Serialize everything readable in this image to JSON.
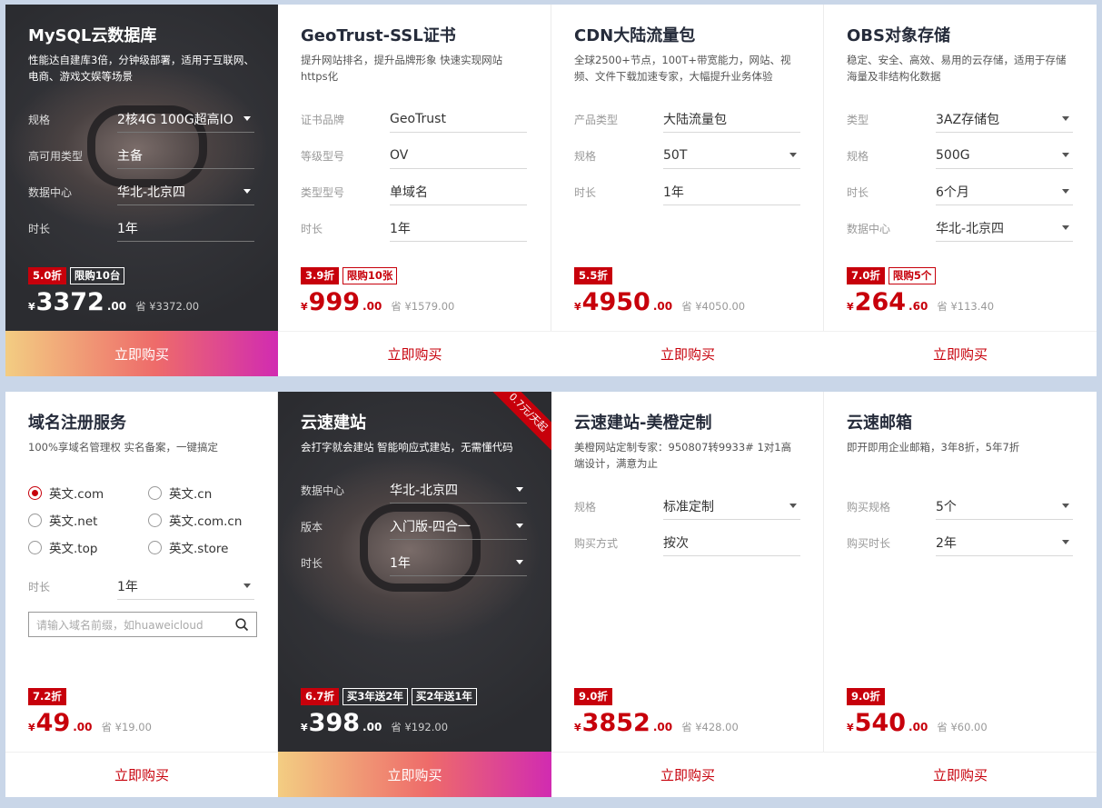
{
  "buy_label": "立即购买",
  "cards": [
    {
      "title": "MySQL云数据库",
      "desc": "性能达自建库3倍，分钟级部署，适用于互联网、电商、游戏文娱等场景",
      "rows": [
        {
          "label": "规格",
          "value": "2核4G 100G超高IO"
        },
        {
          "label": "高可用类型",
          "value": "主备"
        },
        {
          "label": "数据中心",
          "value": "华北-北京四"
        },
        {
          "label": "时长",
          "value": "1年"
        }
      ],
      "badges": [
        "5.0折",
        "限购10台"
      ],
      "currency": "¥",
      "price": "3372",
      "decimal": ".00",
      "save": "省 ¥3372.00"
    },
    {
      "title": "GeoTrust-SSL证书",
      "desc": "提升网站排名，提升品牌形象 快速实现网站https化",
      "rows": [
        {
          "label": "证书品牌",
          "value": "GeoTrust"
        },
        {
          "label": "等级型号",
          "value": "OV"
        },
        {
          "label": "类型型号",
          "value": "单域名"
        },
        {
          "label": "时长",
          "value": "1年"
        }
      ],
      "badges": [
        "3.9折",
        "限购10张"
      ],
      "currency": "¥",
      "price": "999",
      "decimal": ".00",
      "save": "省 ¥1579.00"
    },
    {
      "title": "CDN大陆流量包",
      "desc": "全球2500+节点，100T+带宽能力，网站、视频、文件下载加速专家，大幅提升业务体验",
      "rows": [
        {
          "label": "产品类型",
          "value": "大陆流量包"
        },
        {
          "label": "规格",
          "value": "50T"
        },
        {
          "label": "时长",
          "value": "1年"
        }
      ],
      "badges": [
        "5.5折"
      ],
      "currency": "¥",
      "price": "4950",
      "decimal": ".00",
      "save": "省 ¥4050.00"
    },
    {
      "title": "OBS对象存储",
      "desc": "稳定、安全、高效、易用的云存储，适用于存储海量及非结构化数据",
      "rows": [
        {
          "label": "类型",
          "value": "3AZ存储包"
        },
        {
          "label": "规格",
          "value": "500G"
        },
        {
          "label": "时长",
          "value": "6个月"
        },
        {
          "label": "数据中心",
          "value": "华北-北京四"
        }
      ],
      "badges": [
        "7.0折",
        "限购5个"
      ],
      "currency": "¥",
      "price": "264",
      "decimal": ".60",
      "save": "省 ¥113.40"
    },
    {
      "title": "域名注册服务",
      "desc": "100%享域名管理权 实名备案，一键搞定",
      "radios": [
        "英文.com",
        "英文.cn",
        "英文.net",
        "英文.com.cn",
        "英文.top",
        "英文.store"
      ],
      "rows": [
        {
          "label": "时长",
          "value": "1年"
        }
      ],
      "search_placeholder": "请输入域名前缀，如huaweicloud",
      "badges": [
        "7.2折"
      ],
      "currency": "¥",
      "price": "49",
      "decimal": ".00",
      "save": "省 ¥19.00"
    },
    {
      "title": "云速建站",
      "desc": "会打字就会建站 智能响应式建站，无需懂代码",
      "ribbon": "0.7元/天起",
      "rows": [
        {
          "label": "数据中心",
          "value": "华北-北京四"
        },
        {
          "label": "版本",
          "value": "入门版-四合一"
        },
        {
          "label": "时长",
          "value": "1年"
        }
      ],
      "badges": [
        "6.7折",
        "买3年送2年",
        "买2年送1年"
      ],
      "currency": "¥",
      "price": "398",
      "decimal": ".00",
      "save": "省 ¥192.00"
    },
    {
      "title": "云速建站-美橙定制",
      "desc": "美橙网站定制专家：950807转9933# 1对1高端设计，满意为止",
      "rows": [
        {
          "label": "规格",
          "value": "标准定制"
        },
        {
          "label": "购买方式",
          "value": "按次"
        }
      ],
      "badges": [
        "9.0折"
      ],
      "currency": "¥",
      "price": "3852",
      "decimal": ".00",
      "save": "省 ¥428.00"
    },
    {
      "title": "云速邮箱",
      "desc": "即开即用企业邮箱，3年8折，5年7折",
      "rows": [
        {
          "label": "购买规格",
          "value": "5个"
        },
        {
          "label": "购买时长",
          "value": "2年"
        }
      ],
      "badges": [
        "9.0折"
      ],
      "currency": "¥",
      "price": "540",
      "decimal": ".00",
      "save": "省 ¥60.00"
    }
  ]
}
